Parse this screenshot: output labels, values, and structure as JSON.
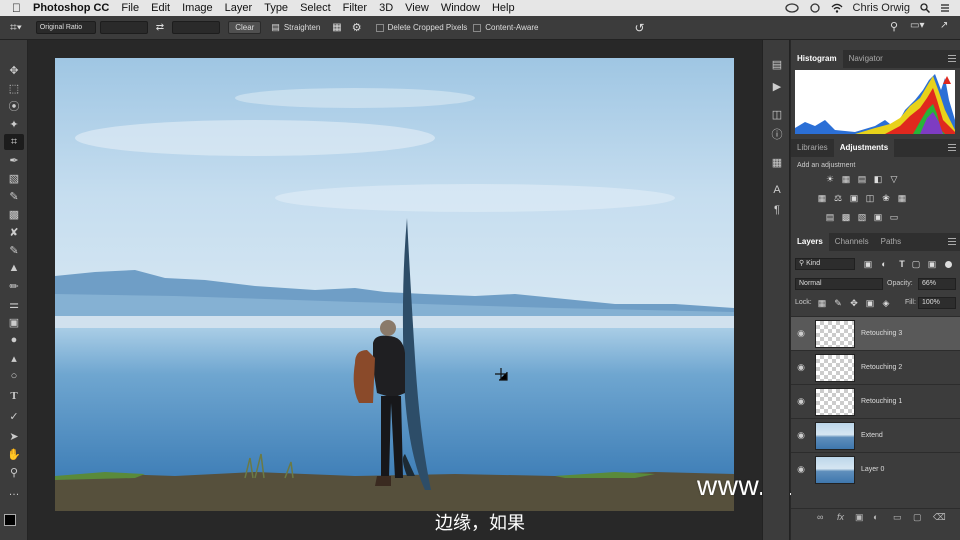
{
  "menubar": {
    "app_name": "Photoshop CC",
    "items": [
      "File",
      "Edit",
      "Image",
      "Layer",
      "Type",
      "Select",
      "Filter",
      "3D",
      "View",
      "Window",
      "Help"
    ],
    "user": "Chris Orwig"
  },
  "options": {
    "ratio_label": "Original Ratio",
    "clear_label": "Clear",
    "straighten_label": "Straighten",
    "delete_cropped_label": "Delete Cropped Pixels",
    "content_aware_label": "Content-Aware"
  },
  "tools": [
    "move-tool",
    "marquee-tool",
    "lasso-tool",
    "quick-select-tool",
    "crop-tool",
    "eyedropper-tool",
    "healing-brush-tool",
    "brush-tool",
    "clone-stamp-tool",
    "history-brush-tool",
    "eraser-tool",
    "gradient-tool",
    "blur-tool",
    "dodge-tool",
    "pen-tool",
    "type-tool",
    "path-select-tool",
    "shape-tool",
    "hand-tool",
    "zoom-tool",
    "more-tools"
  ],
  "histogram_panel": {
    "tabs": [
      "Histogram",
      "Navigator"
    ]
  },
  "adjustments_panel": {
    "tabs": [
      "Libraries",
      "Adjustments"
    ],
    "add_label": "Add an adjustment"
  },
  "layers_panel": {
    "tabs": [
      "Layers",
      "Channels",
      "Paths"
    ],
    "kind_filter": "Kind",
    "blend_mode": "Normal",
    "opacity_label": "Opacity:",
    "opacity_value": "66%",
    "lock_label": "Lock:",
    "fill_label": "Fill:",
    "fill_value": "100%",
    "layers": [
      {
        "name": "Retouching 3",
        "selected": true
      },
      {
        "name": "Retouching 2",
        "selected": false
      },
      {
        "name": "Retouching 1",
        "selected": false
      },
      {
        "name": "Extend",
        "selected": false
      },
      {
        "name": "Layer 0",
        "selected": false
      }
    ]
  },
  "watermark": "www.hunls.com",
  "subtitle": "边缘，如果"
}
